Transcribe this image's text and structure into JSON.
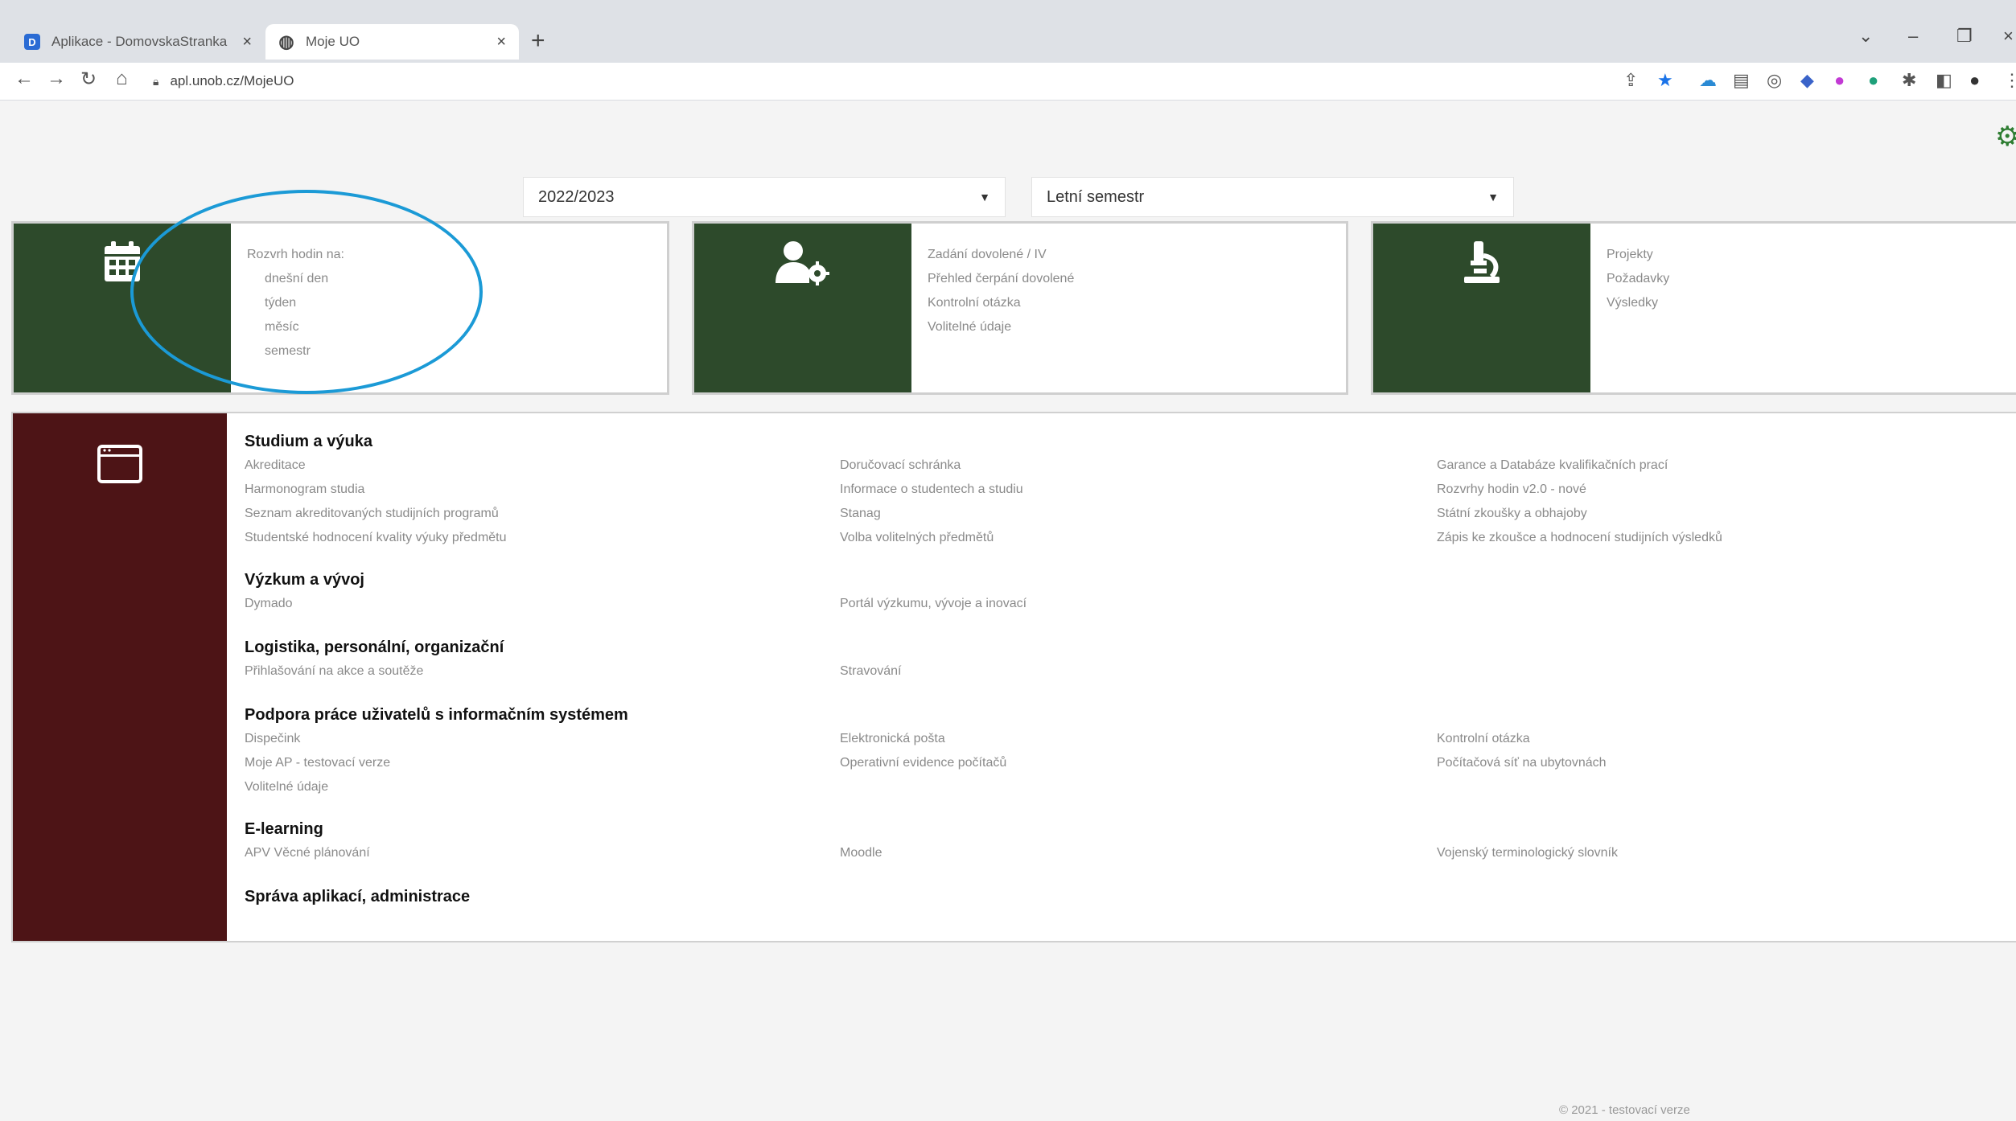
{
  "browser": {
    "tabs": [
      {
        "title": "Aplikace - DomovskaStranka",
        "favicon": "app-icon"
      },
      {
        "title": "Moje UO",
        "favicon": "globe-icon"
      }
    ],
    "new_tab": "+",
    "url": "apl.unob.cz/MojeUO"
  },
  "filters": {
    "year": "2022/2023",
    "semester": "Letní semestr"
  },
  "tiles": [
    {
      "icon": "calendar-icon",
      "items": [
        "Rozvrh hodin na:",
        "dnešní den",
        "týden",
        "měsíc",
        "semestr"
      ]
    },
    {
      "icon": "user-settings-icon",
      "items": [
        "Zadání dovolené / IV",
        "Přehled čerpání dovolené",
        "Kontrolní otázka",
        "Volitelné údaje"
      ]
    },
    {
      "icon": "microscope-icon",
      "items": [
        "Projekty",
        "Požadavky",
        "Výsledky"
      ]
    }
  ],
  "apps": {
    "icon": "window-icon",
    "sections": [
      {
        "title": "Studium a výuka",
        "columns": [
          [
            "Akreditace",
            "Harmonogram studia",
            "Seznam akreditovaných studijních programů",
            "Studentské hodnocení kvality výuky předmětu"
          ],
          [
            "Doručovací schránka",
            "Informace o studentech a studiu",
            "Stanag",
            "Volba volitelných předmětů"
          ],
          [
            "Garance a Databáze kvalifikačních prací",
            "Rozvrhy hodin v2.0 - nové",
            "Státní zkoušky a obhajoby",
            "Zápis ke zkoušce a hodnocení studijních výsledků"
          ]
        ]
      },
      {
        "title": "Výzkum a vývoj",
        "columns": [
          [
            "Dymado"
          ],
          [
            "Portál výzkumu, vývoje a inovací"
          ],
          []
        ]
      },
      {
        "title": "Logistika, personální, organizační",
        "columns": [
          [
            "Přihlašování na akce a soutěže"
          ],
          [
            "Stravování"
          ],
          []
        ]
      },
      {
        "title": "Podpora práce uživatelů s informačním systémem",
        "columns": [
          [
            "Dispečink",
            "Moje AP - testovací verze",
            "Volitelné údaje"
          ],
          [
            "Elektronická pošta",
            "Operativní evidence počítačů"
          ],
          [
            "Kontrolní otázka",
            "Počítačová síť na ubytovnách"
          ]
        ]
      },
      {
        "title": "E-learning",
        "columns": [
          [
            "APV Věcné plánování"
          ],
          [
            "Moodle"
          ],
          [
            "Vojenský terminologický slovník"
          ]
        ]
      },
      {
        "title": "Správa aplikací, administrace",
        "columns": [
          [],
          [],
          []
        ]
      }
    ]
  },
  "footer": "© 2021 - testovací verze"
}
